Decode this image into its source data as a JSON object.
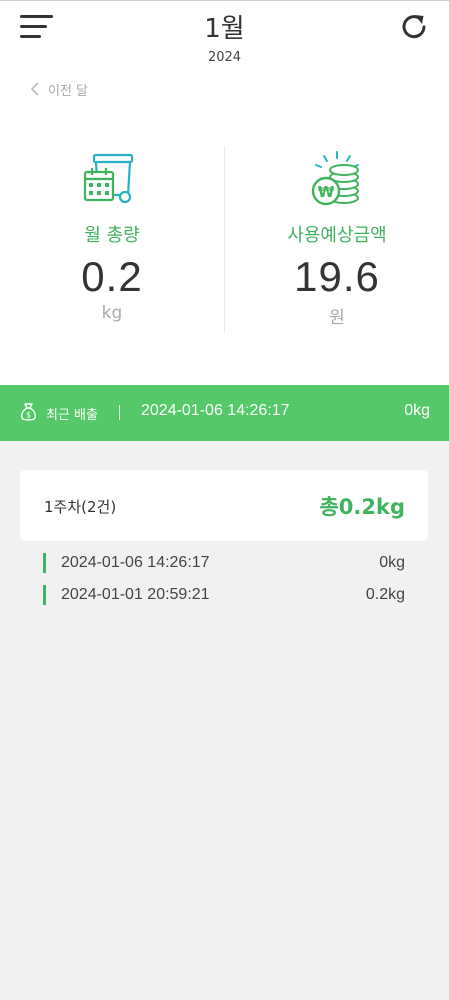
{
  "header": {
    "month": "1월",
    "year": "2024",
    "prev_label": "이전 달"
  },
  "stats": {
    "monthly_total": {
      "label": "월 총량",
      "value": "0.2",
      "unit": "kg"
    },
    "estimated_cost": {
      "label": "사용예상금액",
      "value": "19.6",
      "unit": "원"
    }
  },
  "recent": {
    "label": "최근 배출",
    "time": "2024-01-06 14:26:17",
    "weight": "0kg"
  },
  "week": {
    "label": "1주차(2건)",
    "total": "총0.2kg"
  },
  "records": [
    {
      "time": "2024-01-06 14:26:17",
      "weight": "0kg"
    },
    {
      "time": "2024-01-01 20:59:21",
      "weight": "0.2kg"
    }
  ],
  "colors": {
    "accent": "#3fb35e",
    "bar": "#55c869",
    "background": "#f1f1f1"
  },
  "icons": [
    "menu-icon",
    "refresh-icon",
    "chevron-left-icon",
    "trash-bin-calendar-icon",
    "won-coins-icon",
    "money-bag-icon"
  ]
}
